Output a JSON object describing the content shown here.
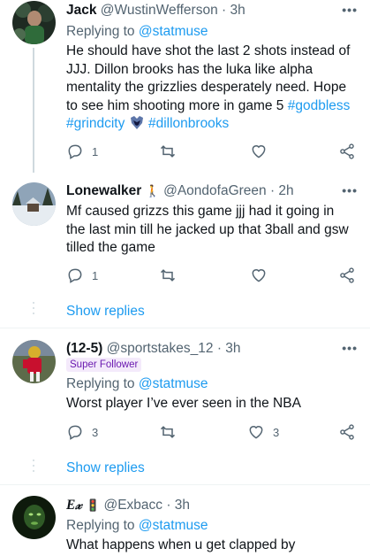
{
  "tweets": [
    {
      "name": "Jack",
      "handle": "@WustinWefferson",
      "time": "· 3h",
      "replying_label": "Replying to",
      "replying_handle": "@statmuse",
      "text_1": "He should have shot the last 2 shots instead of JJJ. Dillon brooks has the luka like alpha mentality the grizzlies desperately need. Hope to see him shooting more in game 5 ",
      "tag_1": "#godbless",
      "tag_2": "#grindcity",
      "tag_3": "#dillonbrooks",
      "reply_count": "1",
      "retweet_count": "",
      "like_count": ""
    },
    {
      "name": "Lonewalker",
      "name_emoji": "🚶",
      "handle": "@AondofaGreen",
      "time": "· 2h",
      "text": "Mf caused grizzs this game jjj had it going in the last min till he jacked up that 3ball and gsw tilled the game",
      "reply_count": "1",
      "retweet_count": "",
      "like_count": "",
      "show_replies": "Show replies"
    },
    {
      "name": "(12-5)",
      "handle": "@sportstakes_12",
      "time": "· 3h",
      "badge": "Super Follower",
      "replying_label": "Replying to",
      "replying_handle": "@statmuse",
      "text": "Worst player I’ve ever seen in the NBA",
      "reply_count": "3",
      "retweet_count": "",
      "like_count": "3",
      "show_replies": "Show replies"
    },
    {
      "name": "E𝓍",
      "name_emoji": "🚦",
      "handle": "@Exbacc",
      "time": "· 3h",
      "replying_label": "Replying to",
      "replying_handle": "@statmuse",
      "text": "What happens when u get clapped by"
    }
  ],
  "more_label": "•••",
  "colors": {
    "accent": "#1d9bf0",
    "muted": "#536471",
    "text": "#0f1419"
  },
  "icons": [
    "reply-icon",
    "retweet-icon",
    "like-icon",
    "share-icon",
    "more-icon",
    "grizzlies-logo-icon"
  ]
}
